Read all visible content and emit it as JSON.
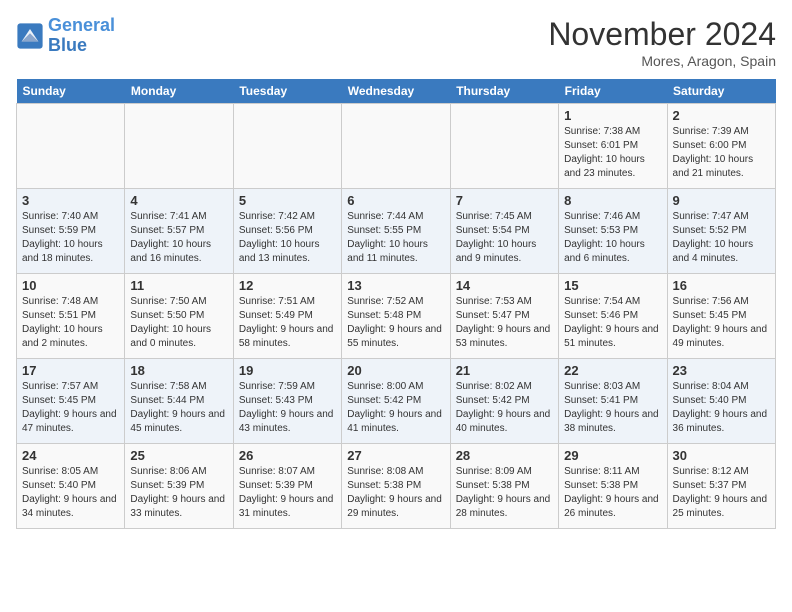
{
  "header": {
    "logo_line1": "General",
    "logo_line2": "Blue",
    "month": "November 2024",
    "location": "Mores, Aragon, Spain"
  },
  "days_of_week": [
    "Sunday",
    "Monday",
    "Tuesday",
    "Wednesday",
    "Thursday",
    "Friday",
    "Saturday"
  ],
  "weeks": [
    [
      {
        "day": "",
        "info": ""
      },
      {
        "day": "",
        "info": ""
      },
      {
        "day": "",
        "info": ""
      },
      {
        "day": "",
        "info": ""
      },
      {
        "day": "",
        "info": ""
      },
      {
        "day": "1",
        "info": "Sunrise: 7:38 AM\nSunset: 6:01 PM\nDaylight: 10 hours and 23 minutes."
      },
      {
        "day": "2",
        "info": "Sunrise: 7:39 AM\nSunset: 6:00 PM\nDaylight: 10 hours and 21 minutes."
      }
    ],
    [
      {
        "day": "3",
        "info": "Sunrise: 7:40 AM\nSunset: 5:59 PM\nDaylight: 10 hours and 18 minutes."
      },
      {
        "day": "4",
        "info": "Sunrise: 7:41 AM\nSunset: 5:57 PM\nDaylight: 10 hours and 16 minutes."
      },
      {
        "day": "5",
        "info": "Sunrise: 7:42 AM\nSunset: 5:56 PM\nDaylight: 10 hours and 13 minutes."
      },
      {
        "day": "6",
        "info": "Sunrise: 7:44 AM\nSunset: 5:55 PM\nDaylight: 10 hours and 11 minutes."
      },
      {
        "day": "7",
        "info": "Sunrise: 7:45 AM\nSunset: 5:54 PM\nDaylight: 10 hours and 9 minutes."
      },
      {
        "day": "8",
        "info": "Sunrise: 7:46 AM\nSunset: 5:53 PM\nDaylight: 10 hours and 6 minutes."
      },
      {
        "day": "9",
        "info": "Sunrise: 7:47 AM\nSunset: 5:52 PM\nDaylight: 10 hours and 4 minutes."
      }
    ],
    [
      {
        "day": "10",
        "info": "Sunrise: 7:48 AM\nSunset: 5:51 PM\nDaylight: 10 hours and 2 minutes."
      },
      {
        "day": "11",
        "info": "Sunrise: 7:50 AM\nSunset: 5:50 PM\nDaylight: 10 hours and 0 minutes."
      },
      {
        "day": "12",
        "info": "Sunrise: 7:51 AM\nSunset: 5:49 PM\nDaylight: 9 hours and 58 minutes."
      },
      {
        "day": "13",
        "info": "Sunrise: 7:52 AM\nSunset: 5:48 PM\nDaylight: 9 hours and 55 minutes."
      },
      {
        "day": "14",
        "info": "Sunrise: 7:53 AM\nSunset: 5:47 PM\nDaylight: 9 hours and 53 minutes."
      },
      {
        "day": "15",
        "info": "Sunrise: 7:54 AM\nSunset: 5:46 PM\nDaylight: 9 hours and 51 minutes."
      },
      {
        "day": "16",
        "info": "Sunrise: 7:56 AM\nSunset: 5:45 PM\nDaylight: 9 hours and 49 minutes."
      }
    ],
    [
      {
        "day": "17",
        "info": "Sunrise: 7:57 AM\nSunset: 5:45 PM\nDaylight: 9 hours and 47 minutes."
      },
      {
        "day": "18",
        "info": "Sunrise: 7:58 AM\nSunset: 5:44 PM\nDaylight: 9 hours and 45 minutes."
      },
      {
        "day": "19",
        "info": "Sunrise: 7:59 AM\nSunset: 5:43 PM\nDaylight: 9 hours and 43 minutes."
      },
      {
        "day": "20",
        "info": "Sunrise: 8:00 AM\nSunset: 5:42 PM\nDaylight: 9 hours and 41 minutes."
      },
      {
        "day": "21",
        "info": "Sunrise: 8:02 AM\nSunset: 5:42 PM\nDaylight: 9 hours and 40 minutes."
      },
      {
        "day": "22",
        "info": "Sunrise: 8:03 AM\nSunset: 5:41 PM\nDaylight: 9 hours and 38 minutes."
      },
      {
        "day": "23",
        "info": "Sunrise: 8:04 AM\nSunset: 5:40 PM\nDaylight: 9 hours and 36 minutes."
      }
    ],
    [
      {
        "day": "24",
        "info": "Sunrise: 8:05 AM\nSunset: 5:40 PM\nDaylight: 9 hours and 34 minutes."
      },
      {
        "day": "25",
        "info": "Sunrise: 8:06 AM\nSunset: 5:39 PM\nDaylight: 9 hours and 33 minutes."
      },
      {
        "day": "26",
        "info": "Sunrise: 8:07 AM\nSunset: 5:39 PM\nDaylight: 9 hours and 31 minutes."
      },
      {
        "day": "27",
        "info": "Sunrise: 8:08 AM\nSunset: 5:38 PM\nDaylight: 9 hours and 29 minutes."
      },
      {
        "day": "28",
        "info": "Sunrise: 8:09 AM\nSunset: 5:38 PM\nDaylight: 9 hours and 28 minutes."
      },
      {
        "day": "29",
        "info": "Sunrise: 8:11 AM\nSunset: 5:38 PM\nDaylight: 9 hours and 26 minutes."
      },
      {
        "day": "30",
        "info": "Sunrise: 8:12 AM\nSunset: 5:37 PM\nDaylight: 9 hours and 25 minutes."
      }
    ]
  ]
}
